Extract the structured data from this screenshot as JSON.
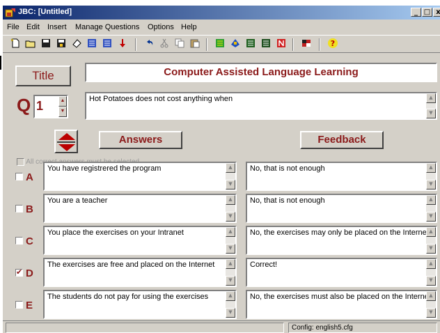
{
  "window": {
    "title": "JBC: [Untitled]",
    "controls": {
      "minimize": "_",
      "maximize": "□",
      "close": "x"
    }
  },
  "menu": [
    "File",
    "Edit",
    "Insert",
    "Manage Questions",
    "Options",
    "Help"
  ],
  "toolbar": {
    "icons": [
      "new-file-icon",
      "open-folder-icon",
      "save-icon",
      "save-as-icon",
      "eraser-icon",
      "web-page-icon",
      "web-page-alt-icon",
      "arrow-down-icon",
      "undo-icon",
      "cut-icon",
      "copy-icon",
      "paste-icon",
      "tool-a-icon",
      "tool-b-icon",
      "tool-c-icon",
      "tool-d-icon",
      "tool-e-icon",
      "flag-icon",
      "help-icon"
    ]
  },
  "title_section": {
    "button_label": "Title",
    "value": "Computer Assisted Language Learning"
  },
  "question": {
    "letter": "Q",
    "number": "1",
    "text": "Hot Potatoes does not cost anything when"
  },
  "headers": {
    "answers": "Answers",
    "feedback": "Feedback"
  },
  "all_correct_label": "All correct answers must be selected",
  "answers": [
    {
      "letter": "A",
      "checked": false,
      "answer": "You have registrered the program",
      "feedback": "No, that is not enough"
    },
    {
      "letter": "B",
      "checked": false,
      "answer": "You are a teacher",
      "feedback": "No, that is not enough"
    },
    {
      "letter": "C",
      "checked": false,
      "answer": "You place the exercises on your Intranet",
      "feedback": "No, the exercises may only be placed on the Internet."
    },
    {
      "letter": "D",
      "checked": true,
      "answer": "The exercises are free and placed on the Internet",
      "feedback": "Correct!"
    },
    {
      "letter": "E",
      "checked": false,
      "answer": "The students do not pay for using the exercises",
      "feedback": "No, the exercises must also be placed on the Internet."
    }
  ],
  "status": {
    "config": "Config: english5.cfg"
  },
  "colors": {
    "accent": "#8b1a1a",
    "face": "#d4d0c8",
    "titlebar_start": "#0a246a",
    "titlebar_end": "#a6caf0"
  }
}
